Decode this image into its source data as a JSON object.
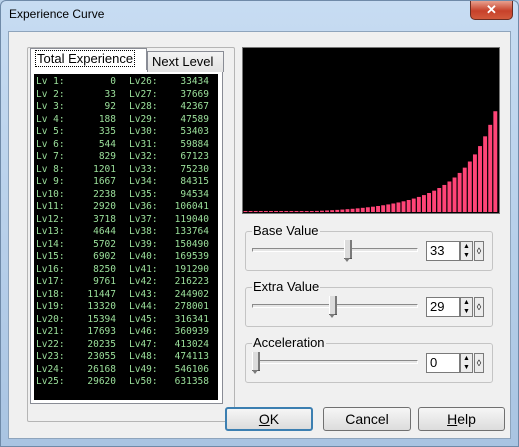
{
  "window": {
    "title": "Experience Curve",
    "close_glyph": "✕"
  },
  "tabs": [
    {
      "label": "Total Experience"
    },
    {
      "label": "Next Level"
    }
  ],
  "experience": {
    "left": [
      {
        "lv": "Lv 1:",
        "val": "0"
      },
      {
        "lv": "Lv 2:",
        "val": "33"
      },
      {
        "lv": "Lv 3:",
        "val": "92"
      },
      {
        "lv": "Lv 4:",
        "val": "188"
      },
      {
        "lv": "Lv 5:",
        "val": "335"
      },
      {
        "lv": "Lv 6:",
        "val": "544"
      },
      {
        "lv": "Lv 7:",
        "val": "829"
      },
      {
        "lv": "Lv 8:",
        "val": "1201"
      },
      {
        "lv": "Lv 9:",
        "val": "1667"
      },
      {
        "lv": "Lv10:",
        "val": "2238"
      },
      {
        "lv": "Lv11:",
        "val": "2920"
      },
      {
        "lv": "Lv12:",
        "val": "3718"
      },
      {
        "lv": "Lv13:",
        "val": "4644"
      },
      {
        "lv": "Lv14:",
        "val": "5702"
      },
      {
        "lv": "Lv15:",
        "val": "6902"
      },
      {
        "lv": "Lv16:",
        "val": "8250"
      },
      {
        "lv": "Lv17:",
        "val": "9761"
      },
      {
        "lv": "Lv18:",
        "val": "11447"
      },
      {
        "lv": "Lv19:",
        "val": "13320"
      },
      {
        "lv": "Lv20:",
        "val": "15394"
      },
      {
        "lv": "Lv21:",
        "val": "17693"
      },
      {
        "lv": "Lv22:",
        "val": "20235"
      },
      {
        "lv": "Lv23:",
        "val": "23055"
      },
      {
        "lv": "Lv24:",
        "val": "26168"
      },
      {
        "lv": "Lv25:",
        "val": "29620"
      }
    ],
    "right": [
      {
        "lv": "Lv26:",
        "val": "33434"
      },
      {
        "lv": "Lv27:",
        "val": "37669"
      },
      {
        "lv": "Lv28:",
        "val": "42367"
      },
      {
        "lv": "Lv29:",
        "val": "47589"
      },
      {
        "lv": "Lv30:",
        "val": "53403"
      },
      {
        "lv": "Lv31:",
        "val": "59884"
      },
      {
        "lv": "Lv32:",
        "val": "67123"
      },
      {
        "lv": "Lv33:",
        "val": "75230"
      },
      {
        "lv": "Lv34:",
        "val": "84315"
      },
      {
        "lv": "Lv35:",
        "val": "94534"
      },
      {
        "lv": "Lv36:",
        "val": "106041"
      },
      {
        "lv": "Lv37:",
        "val": "119040"
      },
      {
        "lv": "Lv38:",
        "val": "133764"
      },
      {
        "lv": "Lv39:",
        "val": "150490"
      },
      {
        "lv": "Lv40:",
        "val": "169539"
      },
      {
        "lv": "Lv41:",
        "val": "191290"
      },
      {
        "lv": "Lv42:",
        "val": "216223"
      },
      {
        "lv": "Lv43:",
        "val": "244902"
      },
      {
        "lv": "Lv44:",
        "val": "278001"
      },
      {
        "lv": "Lv45:",
        "val": "316341"
      },
      {
        "lv": "Lv46:",
        "val": "360939"
      },
      {
        "lv": "Lv47:",
        "val": "413024"
      },
      {
        "lv": "Lv48:",
        "val": "474113"
      },
      {
        "lv": "Lv49:",
        "val": "546106"
      },
      {
        "lv": "Lv50:",
        "val": "631358"
      }
    ]
  },
  "chart_data": {
    "type": "bar",
    "bar_color": "#ff4477",
    "background": "#000000"
  },
  "controls": {
    "base": {
      "label": "Base Value",
      "value": "33",
      "slider_fraction": 0.58
    },
    "extra": {
      "label": "Extra Value",
      "value": "29",
      "slider_fraction": 0.49
    },
    "accel": {
      "label": "Acceleration",
      "value": "0",
      "slider_fraction": 0.0
    },
    "spin_up": "▲",
    "spin_down": "▼",
    "reset": "◊"
  },
  "buttons": {
    "ok": {
      "hotkey": "O",
      "rest": "K"
    },
    "cancel": {
      "label": "Cancel"
    },
    "help": {
      "hotkey": "H",
      "rest": "elp"
    }
  }
}
